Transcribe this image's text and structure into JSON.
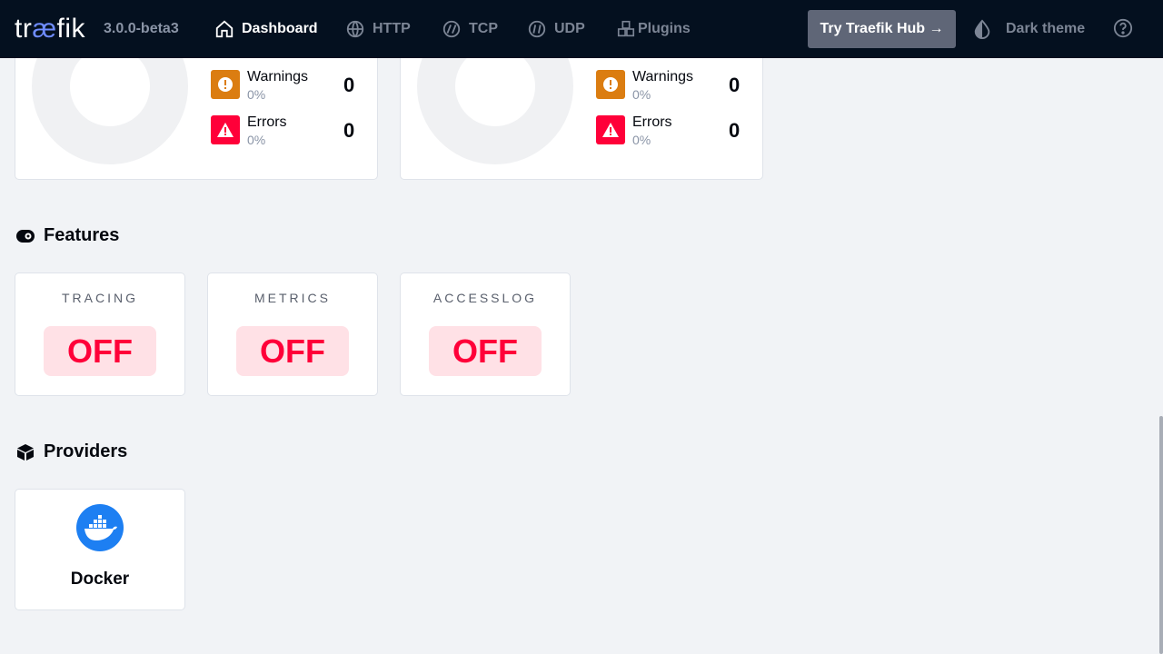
{
  "brand": {
    "logo_t": "tr",
    "logo_ae": "æ",
    "logo_f": "fik",
    "version": "3.0.0-beta3"
  },
  "nav": [
    {
      "label": "Dashboard",
      "icon": "home-icon",
      "active": true
    },
    {
      "label": "HTTP",
      "icon": "globe-icon",
      "active": false
    },
    {
      "label": "TCP",
      "icon": "tcp-icon",
      "active": false
    },
    {
      "label": "UDP",
      "icon": "udp-icon",
      "active": false
    },
    {
      "label": "Plugins",
      "icon": "plugins-icon",
      "active": false
    }
  ],
  "header": {
    "hub_button": "Try Traefik Hub →",
    "theme_label": "Dark theme"
  },
  "stat_cards": [
    {
      "warnings_label": "Warnings",
      "warnings_pct": "0%",
      "warnings_count": "0",
      "errors_label": "Errors",
      "errors_pct": "0%",
      "errors_count": "0"
    },
    {
      "warnings_label": "Warnings",
      "warnings_pct": "0%",
      "warnings_count": "0",
      "errors_label": "Errors",
      "errors_pct": "0%",
      "errors_count": "0"
    }
  ],
  "features": {
    "title": "Features",
    "items": [
      {
        "name": "TRACING",
        "status": "OFF"
      },
      {
        "name": "METRICS",
        "status": "OFF"
      },
      {
        "name": "ACCESSLOG",
        "status": "OFF"
      }
    ]
  },
  "providers": {
    "title": "Providers",
    "items": [
      {
        "name": "Docker",
        "icon": "docker-icon"
      }
    ]
  },
  "colors": {
    "topbar": "#04101f",
    "warning": "#db7d11",
    "error": "#ff0039",
    "off_badge_bg": "#ffe1e6",
    "docker": "#1d7ff2"
  }
}
